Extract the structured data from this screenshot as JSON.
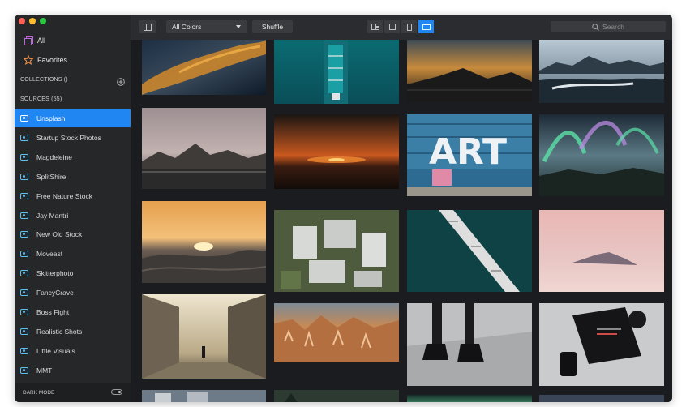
{
  "sidebar": {
    "all_label": "All",
    "favorites_label": "Favorites",
    "collections_label": "COLLECTIONS ()",
    "sources_label": "SOURCES (55)",
    "sources": [
      "Unsplash",
      "Startup Stock Photos",
      "Magdeleine",
      "SplitShire",
      "Free Nature Stock",
      "Jay Mantri",
      "New Old Stock",
      "Moveast",
      "Skitterphoto",
      "FancyCrave",
      "Boss Fight",
      "Realistic Shots",
      "Little Visuals",
      "MMT"
    ],
    "active_source_index": 0,
    "dark_mode_label": "DARK MODE"
  },
  "toolbar": {
    "color_filter": "All Colors",
    "shuffle_label": "Shuffle",
    "search_placeholder": "Search",
    "active_view_index": 3
  },
  "colors": {
    "accent": "#1f86f2",
    "sidebar_bg": "#262729",
    "content_bg": "#1b1c1f"
  }
}
